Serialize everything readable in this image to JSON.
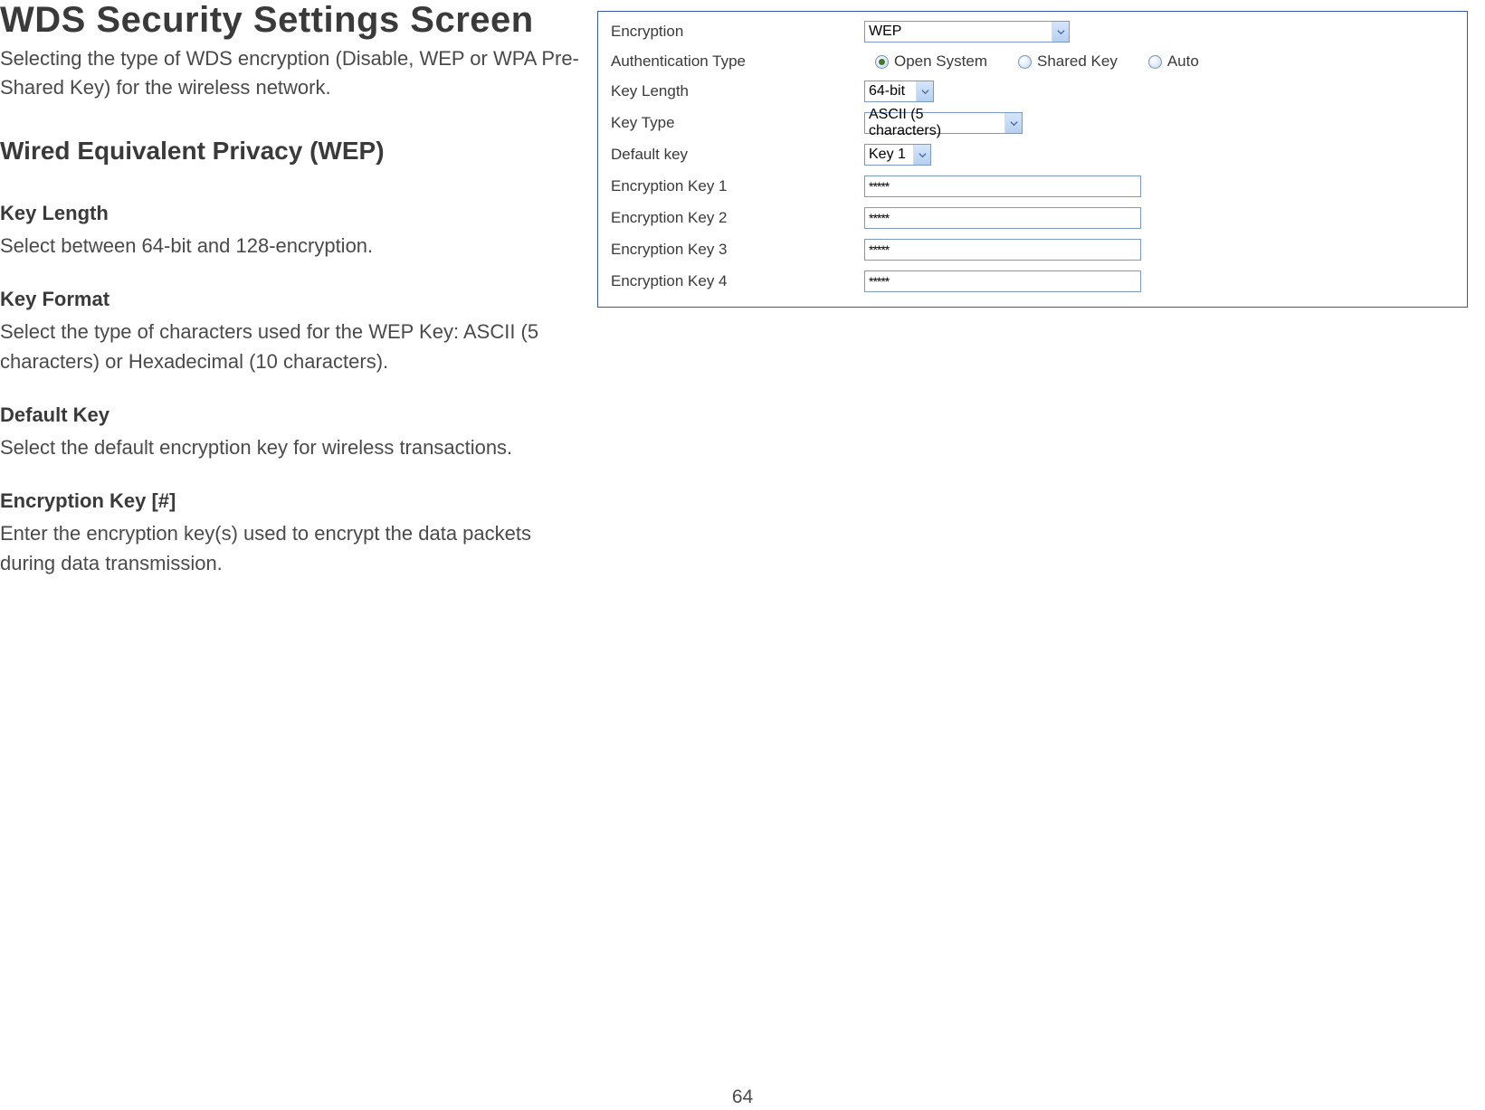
{
  "left": {
    "title": "WDS Security Settings Screen",
    "intro": "Selecting the type of WDS encryption (Disable, WEP or WPA Pre-Shared Key) for the wireless network.",
    "subheading": "Wired Equivalent Privacy (WEP)",
    "fields": [
      {
        "title": "Key Length",
        "desc": "Select between 64-bit and 128-encryption."
      },
      {
        "title": "Key Format",
        "desc": "Select the type of characters used for the WEP Key: ASCII (5 characters) or Hexadecimal (10 characters)."
      },
      {
        "title": "Default Key",
        "desc": "Select the default encryption key for wireless transactions."
      },
      {
        "title": "Encryption Key [#]",
        "desc": "Enter the encryption key(s) used to encrypt the data packets during data transmission."
      }
    ]
  },
  "panel": {
    "encryption": {
      "label": "Encryption",
      "value": "WEP"
    },
    "authType": {
      "label": "Authentication Type",
      "options": [
        {
          "label": "Open System",
          "checked": true
        },
        {
          "label": "Shared Key",
          "checked": false
        },
        {
          "label": "Auto",
          "checked": false
        }
      ]
    },
    "keyLength": {
      "label": "Key Length",
      "value": "64-bit"
    },
    "keyType": {
      "label": "Key Type",
      "value": "ASCII (5 characters)"
    },
    "defaultKey": {
      "label": "Default key",
      "value": "Key 1"
    },
    "keys": [
      {
        "label": "Encryption Key 1",
        "value": "*****"
      },
      {
        "label": "Encryption Key 2",
        "value": "*****"
      },
      {
        "label": "Encryption Key 3",
        "value": "*****"
      },
      {
        "label": "Encryption Key 4",
        "value": "*****"
      }
    ]
  },
  "pageNumber": "64"
}
